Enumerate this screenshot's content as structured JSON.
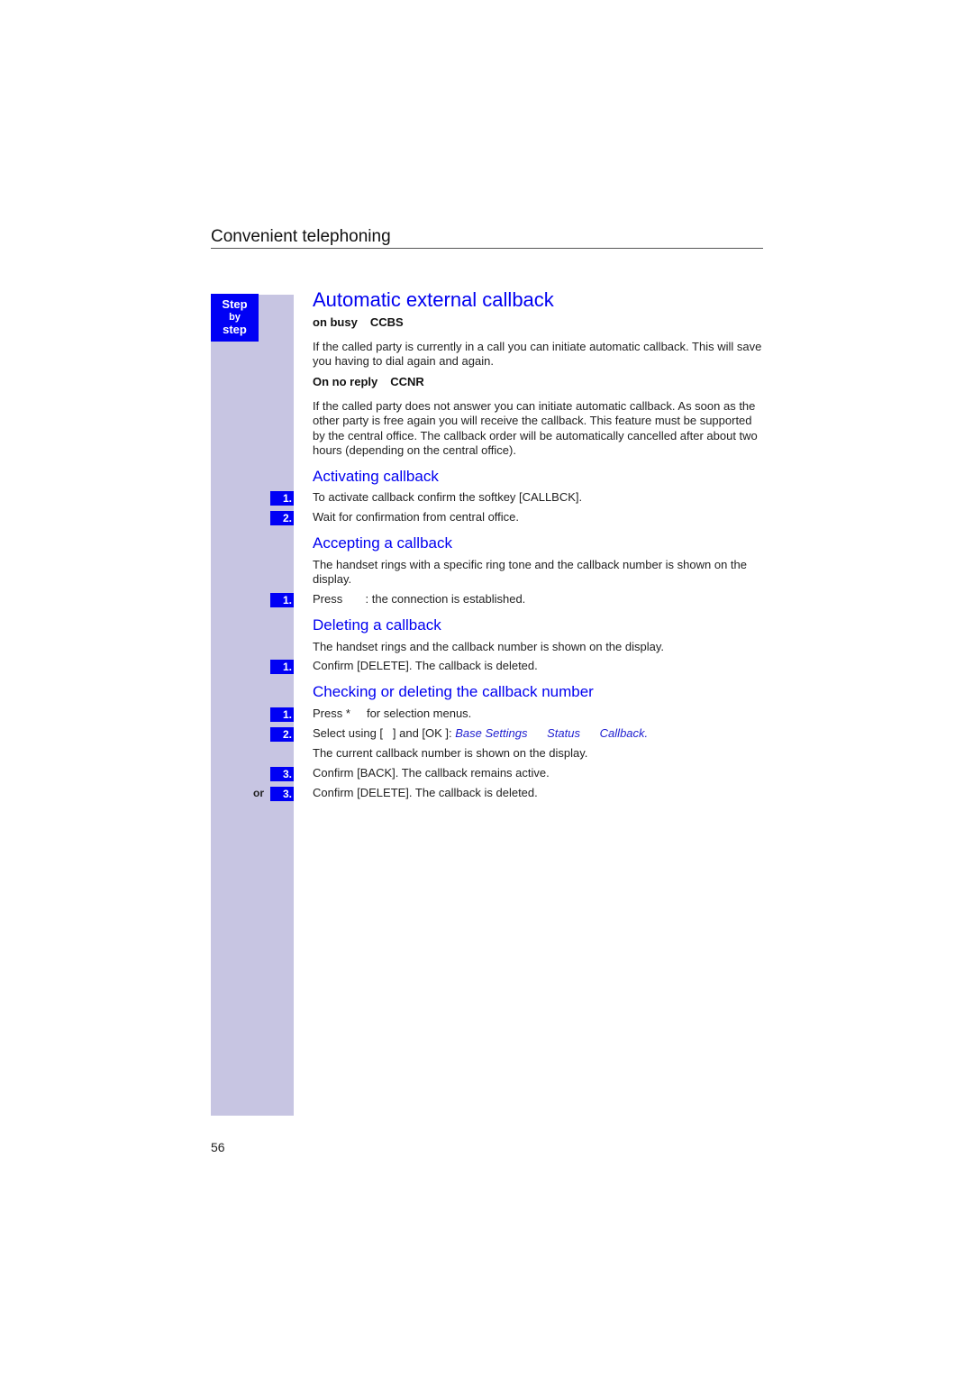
{
  "chapter_title": "Convenient telephoning",
  "step_badge": {
    "line1": "Step",
    "line2": "by",
    "line3": "step"
  },
  "page_title": "Automatic external callback",
  "on_busy": {
    "label": "on busy",
    "code": "CCBS",
    "text": "If the called party is currently in a call you can initiate automatic callback. This will save you having to dial again and again."
  },
  "no_reply": {
    "label": "On no reply",
    "code": "CCNR",
    "text": "If the called party does not answer you can initiate automatic callback. As soon as the other party is free again you will receive the callback. This feature must be supported by the central office. The callback order will be automatically cancelled after about two hours (depending on the central office)."
  },
  "activating": {
    "heading": "Activating callback",
    "steps": [
      {
        "num": "1.",
        "text": "To activate callback confirm the softkey [CALLBCK]."
      },
      {
        "num": "2.",
        "text": "Wait for confirmation from central office."
      }
    ]
  },
  "accepting": {
    "heading": "Accepting a callback",
    "intro": "The handset rings with a specific ring tone and the callback number is shown on the display.",
    "steps": [
      {
        "num": "1.",
        "text": "Press       : the connection is established."
      }
    ]
  },
  "deleting": {
    "heading": "Deleting a callback",
    "intro": "The handset rings and the callback number is shown on the display.",
    "steps": [
      {
        "num": "1.",
        "text": "Confirm [DELETE]. The callback is deleted."
      }
    ]
  },
  "checking": {
    "heading": "Checking or deleting the callback number",
    "step1": {
      "num": "1.",
      "text": "Press *     for selection menus."
    },
    "step2": {
      "num": "2.",
      "prefix": "Select using [   ] and [OK ]: ",
      "menu1": "Base Settings",
      "menu2": "Status",
      "menu3": "Callback."
    },
    "note": "The current callback number is shown on the display.",
    "step3": {
      "num": "3.",
      "text": "Confirm [BACK]. The callback remains active."
    },
    "or_label": "or",
    "step3b": {
      "num": "3.",
      "text": "Confirm [DELETE]. The callback is deleted."
    }
  },
  "page_number": "56"
}
